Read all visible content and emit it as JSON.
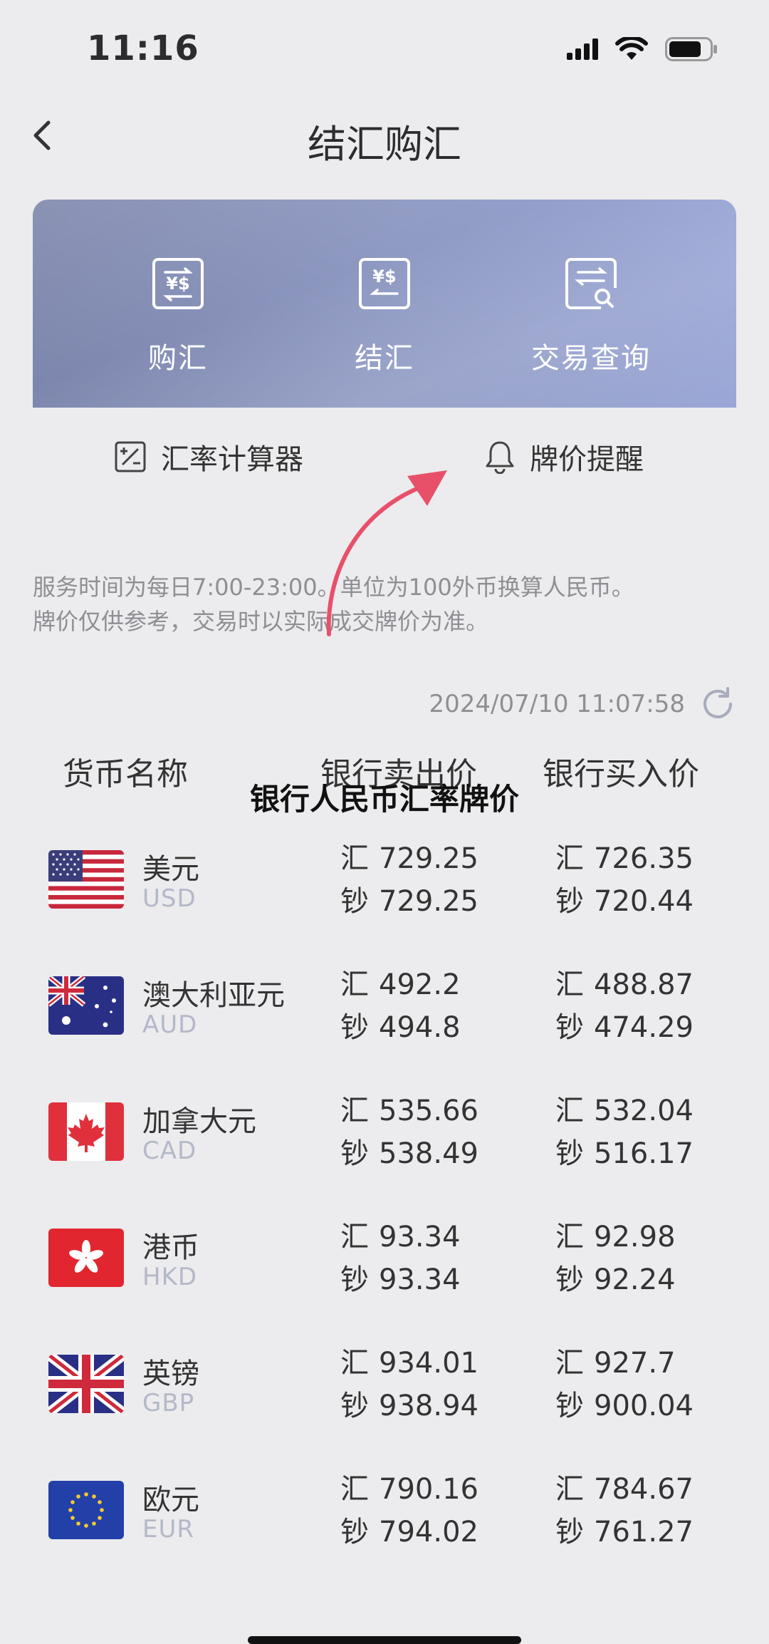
{
  "status": {
    "time": "11:16"
  },
  "nav": {
    "title": "结汇购汇"
  },
  "actions": [
    {
      "label": "购汇",
      "icon": "buy-fx-icon"
    },
    {
      "label": "结汇",
      "icon": "sell-fx-icon"
    },
    {
      "label": "交易查询",
      "icon": "transaction-query-icon"
    }
  ],
  "tools": {
    "calculator": "汇率计算器",
    "alert": "牌价提醒"
  },
  "notice": {
    "line1": "服务时间为每日7:00-23:00。单位为100外币换算人民币。",
    "line2": "牌价仅供参考，交易时以实际成交牌价为准。"
  },
  "timestamp": "2024/07/10 11:07:58",
  "columns": {
    "name": "货币名称",
    "sell": "银行卖出价",
    "buy": "银行买入价"
  },
  "overlay_caption": "银行人民币汇率牌价",
  "labels": {
    "fx": "汇",
    "cash": "钞"
  },
  "currencies": [
    {
      "name": "美元",
      "code": "USD",
      "flag": "us-flag",
      "sell_fx": "729.25",
      "sell_cash": "729.25",
      "buy_fx": "726.35",
      "buy_cash": "720.44"
    },
    {
      "name": "澳大利亚元",
      "code": "AUD",
      "flag": "au-flag",
      "sell_fx": "492.2",
      "sell_cash": "494.8",
      "buy_fx": "488.87",
      "buy_cash": "474.29"
    },
    {
      "name": "加拿大元",
      "code": "CAD",
      "flag": "ca-flag",
      "sell_fx": "535.66",
      "sell_cash": "538.49",
      "buy_fx": "532.04",
      "buy_cash": "516.17"
    },
    {
      "name": "港币",
      "code": "HKD",
      "flag": "hk-flag",
      "sell_fx": "93.34",
      "sell_cash": "93.34",
      "buy_fx": "92.98",
      "buy_cash": "92.24"
    },
    {
      "name": "英镑",
      "code": "GBP",
      "flag": "gb-flag",
      "sell_fx": "934.01",
      "sell_cash": "938.94",
      "buy_fx": "927.7",
      "buy_cash": "900.04"
    },
    {
      "name": "欧元",
      "code": "EUR",
      "flag": "eu-flag",
      "sell_fx": "790.16",
      "sell_cash": "794.02",
      "buy_fx": "784.67",
      "buy_cash": "761.27"
    }
  ],
  "colors": {
    "hero_start": "#7b84aa",
    "hero_end": "#9aa6d6",
    "arrow": "#e8506a",
    "muted": "#8e8e94",
    "code": "#b4b8c8"
  }
}
